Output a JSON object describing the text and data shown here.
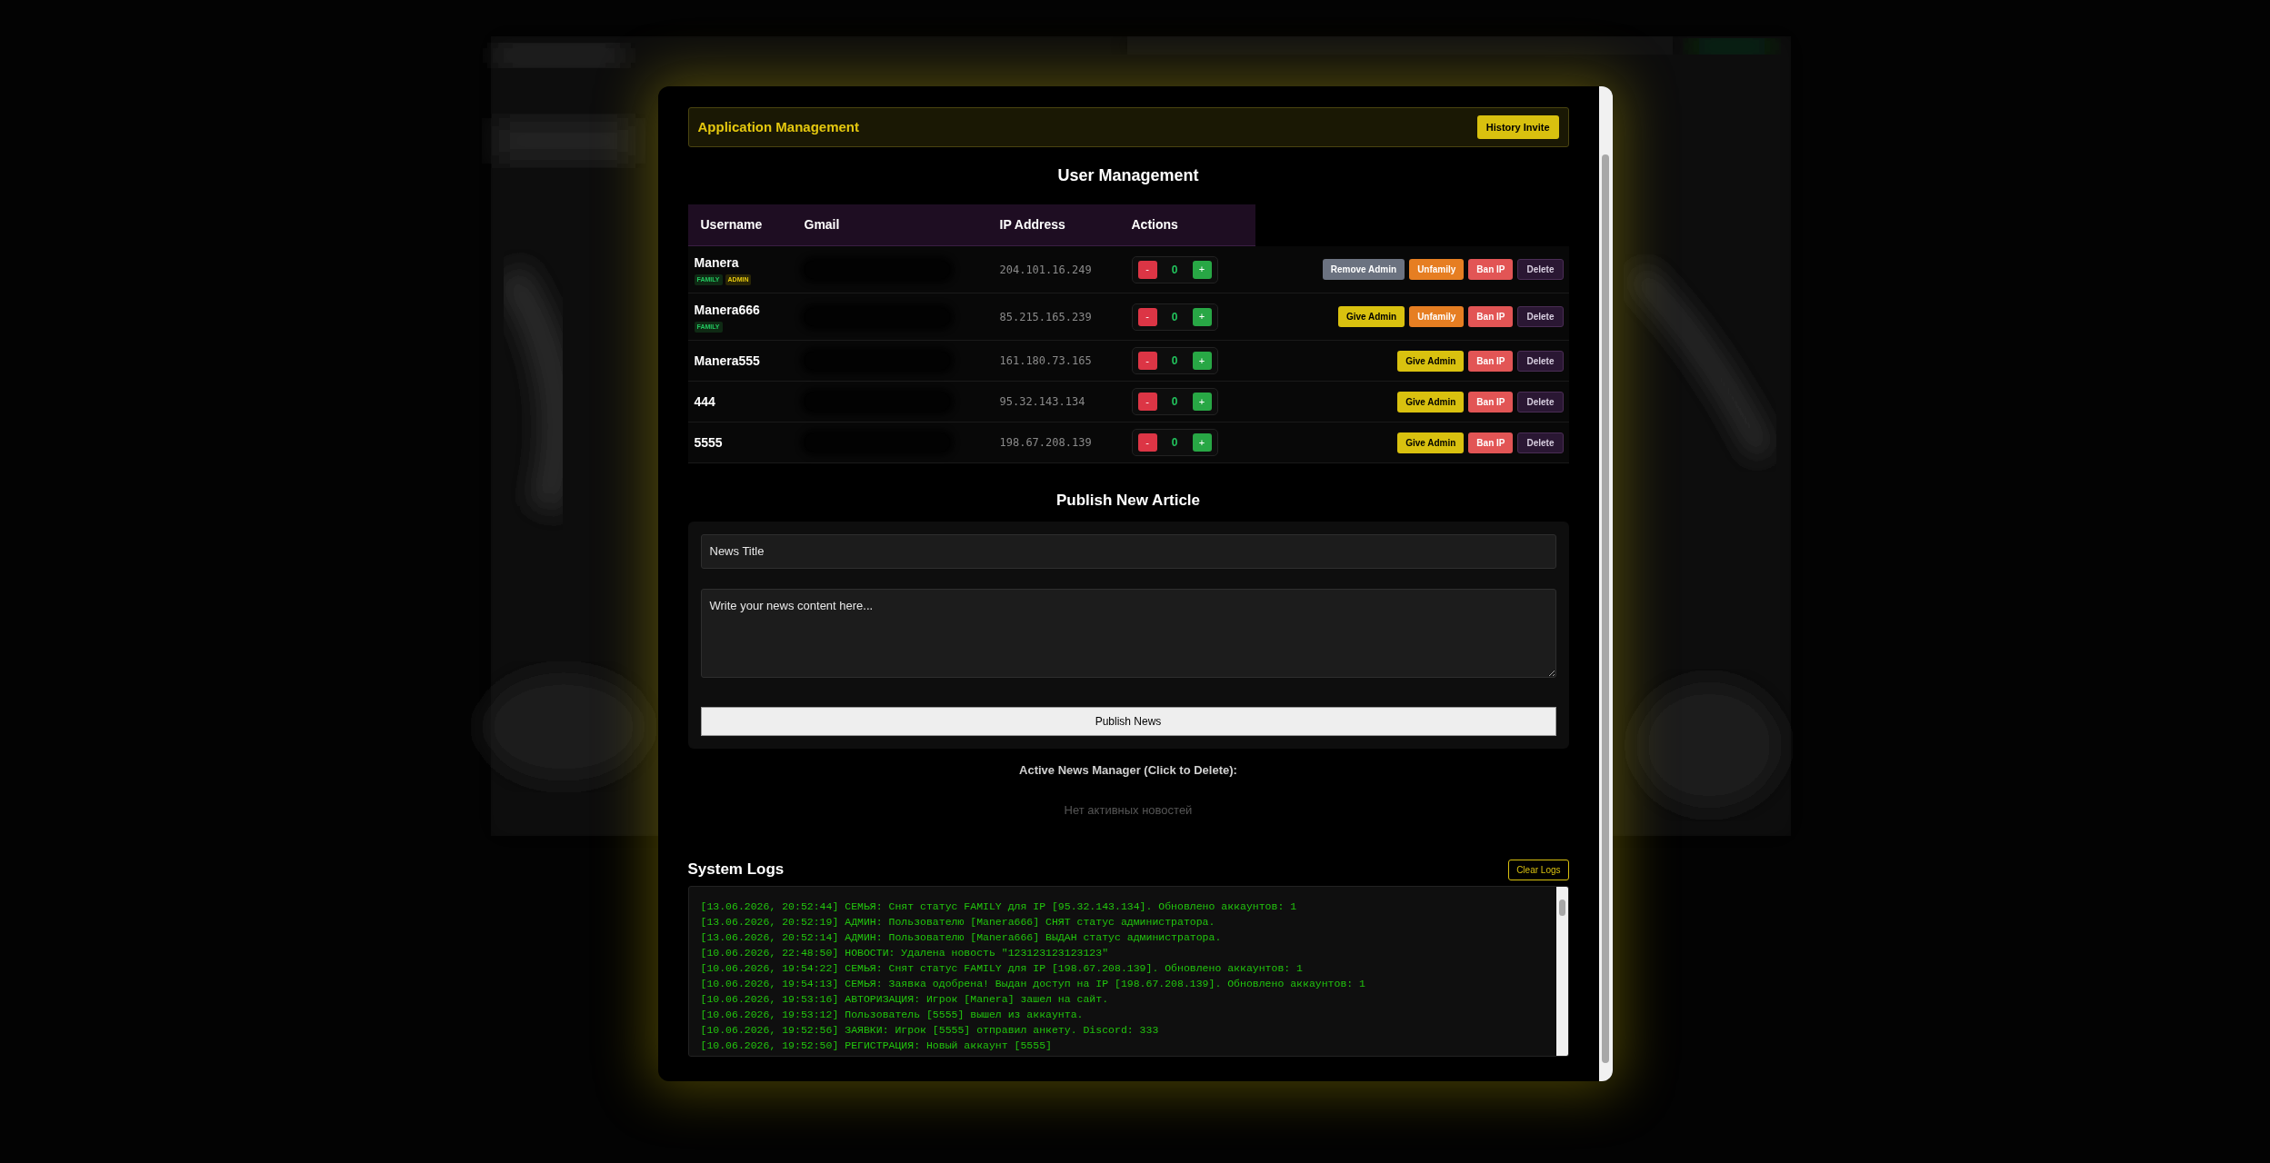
{
  "app_header": {
    "title": "Application Management",
    "button": "History Invite"
  },
  "user_management": {
    "title": "User Management",
    "columns": [
      "Username",
      "Gmail",
      "IP Address",
      "Actions"
    ],
    "rows": [
      {
        "username": "Manera",
        "tags": [
          {
            "label": "FAMILY",
            "kind": "family"
          },
          {
            "label": "ADMIN",
            "kind": "admin"
          }
        ],
        "ip": "204.101.16.249",
        "counter": {
          "minus": "-",
          "value": "0",
          "plus": "+"
        },
        "actions": [
          {
            "label": "Remove Admin",
            "kind": "remove_admin"
          },
          {
            "label": "Unfamily",
            "kind": "unfamily"
          },
          {
            "label": "Ban IP",
            "kind": "ban"
          },
          {
            "label": "Delete",
            "kind": "delete"
          }
        ]
      },
      {
        "username": "Manera666",
        "tags": [
          {
            "label": "FAMILY",
            "kind": "family"
          }
        ],
        "ip": "85.215.165.239",
        "counter": {
          "minus": "-",
          "value": "0",
          "plus": "+"
        },
        "actions": [
          {
            "label": "Give Admin",
            "kind": "give_admin"
          },
          {
            "label": "Unfamily",
            "kind": "unfamily"
          },
          {
            "label": "Ban IP",
            "kind": "ban"
          },
          {
            "label": "Delete",
            "kind": "delete"
          }
        ]
      },
      {
        "username": "Manera555",
        "tags": [],
        "ip": "161.180.73.165",
        "counter": {
          "minus": "-",
          "value": "0",
          "plus": "+"
        },
        "actions": [
          {
            "label": "Give Admin",
            "kind": "give_admin"
          },
          {
            "label": "Ban IP",
            "kind": "ban"
          },
          {
            "label": "Delete",
            "kind": "delete"
          }
        ]
      },
      {
        "username": "444",
        "tags": [],
        "ip": "95.32.143.134",
        "counter": {
          "minus": "-",
          "value": "0",
          "plus": "+"
        },
        "actions": [
          {
            "label": "Give Admin",
            "kind": "give_admin"
          },
          {
            "label": "Ban IP",
            "kind": "ban"
          },
          {
            "label": "Delete",
            "kind": "delete"
          }
        ]
      },
      {
        "username": "5555",
        "tags": [],
        "ip": "198.67.208.139",
        "counter": {
          "minus": "-",
          "value": "0",
          "plus": "+"
        },
        "actions": [
          {
            "label": "Give Admin",
            "kind": "give_admin"
          },
          {
            "label": "Ban IP",
            "kind": "ban"
          },
          {
            "label": "Delete",
            "kind": "delete"
          }
        ]
      }
    ]
  },
  "publish": {
    "title": "Publish New Article",
    "title_field": {
      "placeholder": "News Title"
    },
    "content_field": {
      "placeholder": "Write your news content here..."
    },
    "button": "Publish News"
  },
  "news_manager": {
    "title": "Active News Manager (Click to Delete):",
    "empty": "Нет активных новостей"
  },
  "system_logs": {
    "title": "System Logs",
    "button": "Clear Logs",
    "lines": [
      "[13.06.2026, 20:52:44] СЕМЬЯ: Снят статус FAMILY для IP [95.32.143.134]. Обновлено аккаунтов: 1",
      "[13.06.2026, 20:52:19] АДМИН: Пользователю [Manera666] СНЯТ статус администратора.",
      "[13.06.2026, 20:52:14] АДМИН: Пользователю [Manera666] ВЫДАН статус администратора.",
      "[10.06.2026, 22:48:50] НОВОСТИ: Удалена новость \"123123123123123\"",
      "[10.06.2026, 19:54:22] СЕМЬЯ: Снят статус FAMILY для IP [198.67.208.139]. Обновлено аккаунтов: 1",
      "[10.06.2026, 19:54:13] СЕМЬЯ: Заявка одобрена! Выдан доступ на IP [198.67.208.139]. Обновлено аккаунтов: 1",
      "[10.06.2026, 19:53:16] АВТОРИЗАЦИЯ: Игрок [Manera] зашел на сайт.",
      "[10.06.2026, 19:53:12] Пользователь [5555] вышел из аккаунта.",
      "[10.06.2026, 19:52:56] ЗАЯВКИ: Игрок [5555] отправил анкету. Discord: 333",
      "[10.06.2026, 19:52:50] РЕГИСТРАЦИЯ: Новый аккаунт [5555]"
    ]
  }
}
